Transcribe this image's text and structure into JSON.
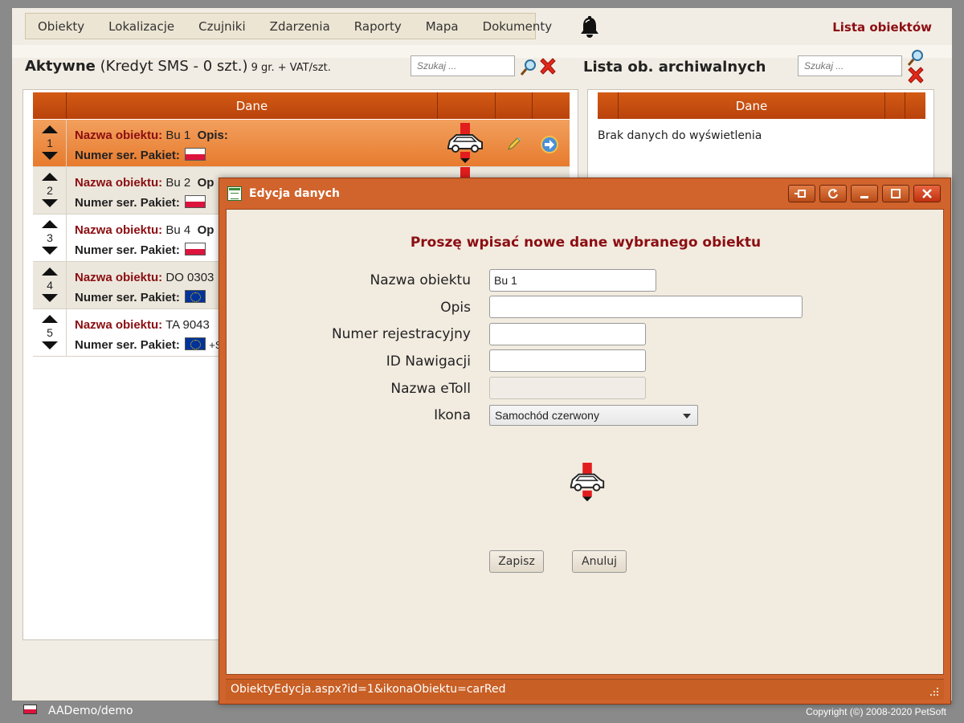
{
  "menu": {
    "items": [
      "Obiekty",
      "Lokalizacje",
      "Czujniki",
      "Zdarzenia",
      "Raporty",
      "Mapa",
      "Dokumenty"
    ]
  },
  "header": {
    "right_title": "Lista obiektów",
    "bell_icon": "bell-icon"
  },
  "left": {
    "title_bold": "Aktywne",
    "title_rest": " (Kredyt SMS - 0 szt.)",
    "title_small": " 9 gr. + VAT/szt.",
    "search_placeholder": "Szukaj ...",
    "col_header": "Dane",
    "rows": [
      {
        "num": "1",
        "name_label": "Nazwa obiektu:",
        "name": " Bu 1",
        "opis": "Opis:",
        "ser": "Numer ser. Pakiet:",
        "flag": "pl"
      },
      {
        "num": "2",
        "name_label": "Nazwa obiektu:",
        "name": " Bu 2",
        "opis": "Op",
        "ser": "Numer ser. Pakiet:",
        "flag": "pl"
      },
      {
        "num": "3",
        "name_label": "Nazwa obiektu:",
        "name": " Bu 4",
        "opis": "Op",
        "ser": "Numer ser. Pakiet:",
        "flag": "pl"
      },
      {
        "num": "4",
        "name_label": "Nazwa obiektu:",
        "name": " DO 0303",
        "opis": "",
        "ser": "Numer ser. Pakiet:",
        "flag": "eu"
      },
      {
        "num": "5",
        "name_label": "Nazwa obiektu:",
        "name": " TA 9043",
        "opis": "",
        "ser": "Numer ser. Pakiet:",
        "flag": "eu",
        "extra": "+S"
      }
    ]
  },
  "right": {
    "title": "Lista ob. archiwalnych",
    "search_placeholder": "Szukaj ...",
    "col_header": "Dane",
    "empty": "Brak danych do wyświetlenia"
  },
  "dialog": {
    "title": "Edycja danych",
    "heading": "Proszę wpisać nowe dane wybranego obiektu",
    "fields": {
      "nazwa": {
        "label": "Nazwa obiektu",
        "value": "Bu 1"
      },
      "opis": {
        "label": "Opis",
        "value": ""
      },
      "rej": {
        "label": "Numer rejestracyjny",
        "value": ""
      },
      "nav": {
        "label": "ID Nawigacji",
        "value": ""
      },
      "etoll": {
        "label": "Nazwa eToll",
        "value": ""
      },
      "ikona": {
        "label": "Ikona",
        "value": "Samochód czerwony"
      }
    },
    "save_label": "Zapisz",
    "cancel_label": "Anuluj",
    "status": "ObiektyEdycja.aspx?id=1&ikonaObiektu=carRed"
  },
  "footer": {
    "user": "AADemo/demo",
    "copyright": "Copyright (©) 2008-2020 PetSoft"
  },
  "colors": {
    "accent": "#d1632c",
    "title_red": "#8b0e12",
    "header_orange": "#c44d10",
    "selected_row": "#ea8a41"
  }
}
